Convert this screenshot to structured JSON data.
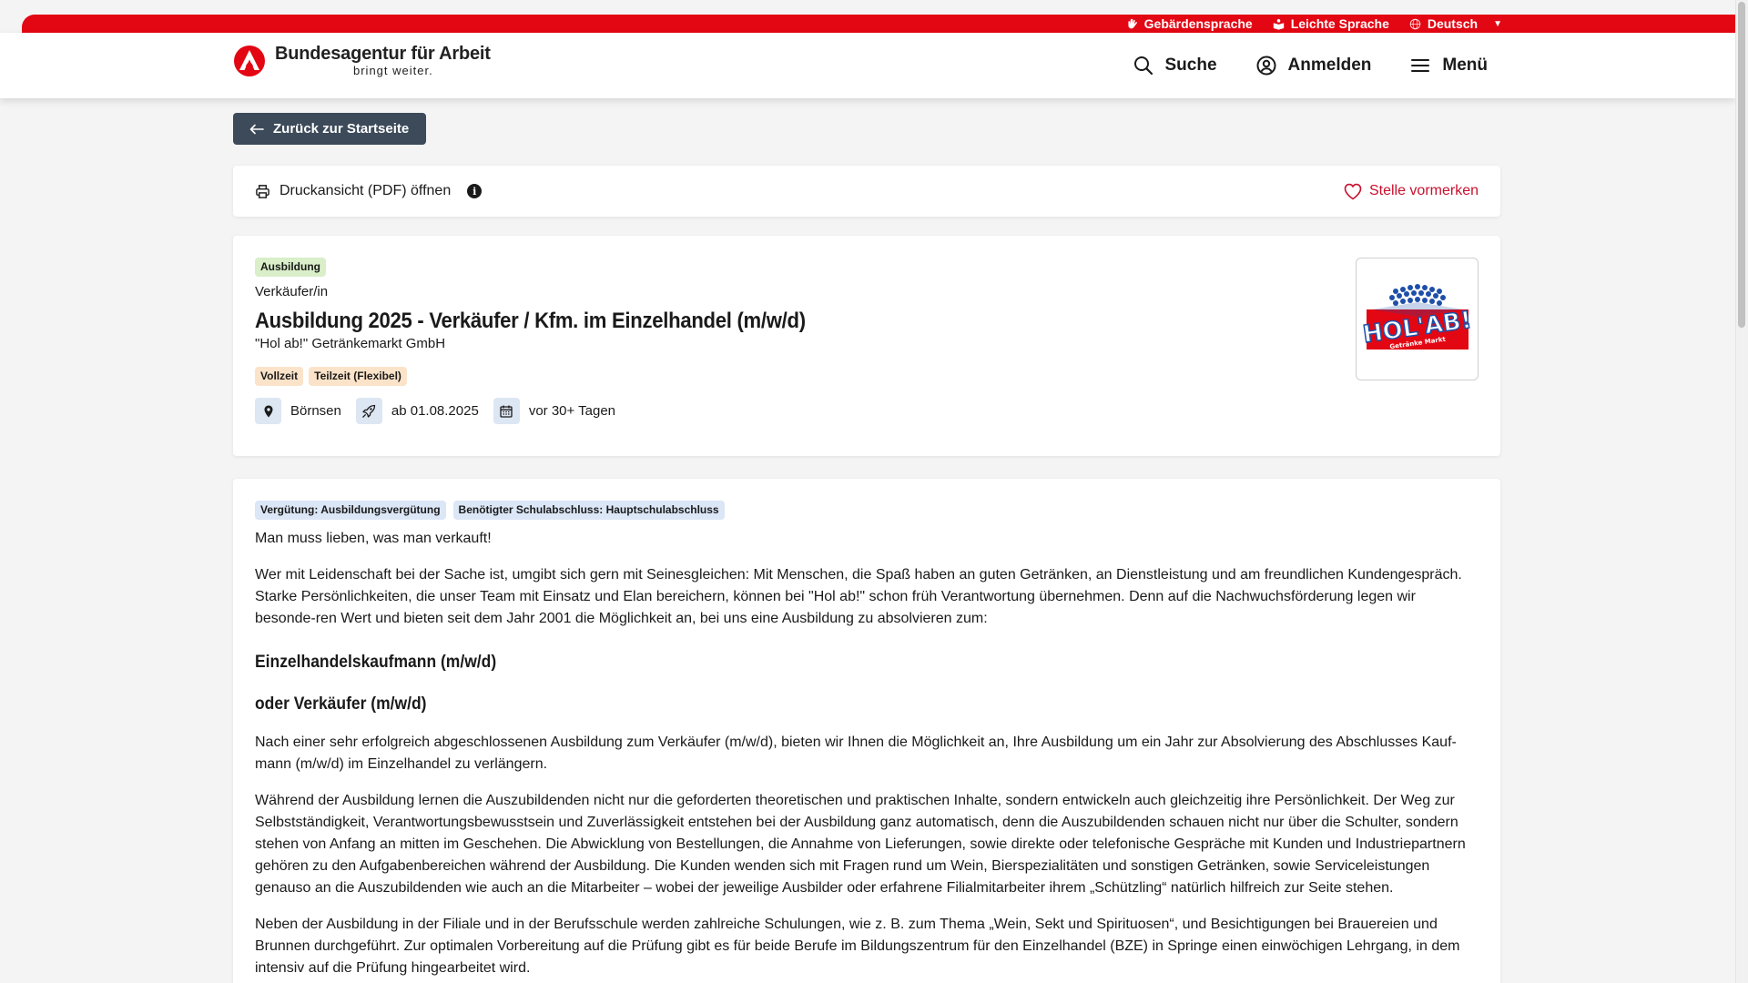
{
  "topbar": {
    "sign_language": "Gebärdensprache",
    "easy_language": "Leichte Sprache",
    "language": "Deutsch"
  },
  "header": {
    "brand_name": "Bundesagentur für Arbeit",
    "brand_tagline": "bringt weiter.",
    "search_label": "Suche",
    "login_label": "Anmelden",
    "menu_label": "Menü"
  },
  "back_button": "Zurück zur Startseite",
  "actions": {
    "print_label": "Druckansicht (PDF) öffnen",
    "bookmark_label": "Stelle vormerken"
  },
  "job": {
    "type_badge": "Ausbildung",
    "occupation": "Verkäufer/in",
    "title": "Ausbildung 2025 - Verkäufer / Kfm. im Einzelhandel (m/w/d)",
    "employer": "\"Hol ab!\" Getränkemarkt GmbH",
    "work_time": [
      "Vollzeit",
      "Teilzeit (Flexibel)"
    ],
    "location": "Börnsen",
    "start": "ab 01.08.2025",
    "posted": "vor 30+ Tagen",
    "logo_text": "HOL'AB!",
    "logo_subtext": "Getränke Markt"
  },
  "description": {
    "tags": [
      "Vergütung: Ausbildungsvergütung",
      "Benötigter Schulabschluss: Hauptschulabschluss"
    ],
    "intro": "Man muss lieben, was man verkauft!",
    "para1": "Wer mit Leidenschaft bei der Sache ist, umgibt sich gern mit Seinesgleichen: Mit Menschen, die Spaß haben an guten Getränken, an Dienstleistung und am freundlichen Kundengespräch. Starke Persönlichkeiten, die unser Team mit Einsatz und Elan bereichern, können bei \"Hol ab!\" schon früh Verantwortung übernehmen. Denn auf die Nachwuchsförderung legen wir besonde-ren Wert und bieten seit dem Jahr 2001 die Möglichkeit an, bei uns eine Ausbildung zu absolvieren zum:",
    "heading1": "Einzelhandelskaufmann (m/w/d)",
    "heading2": "oder Verkäufer (m/w/d)",
    "para2": "Nach einer sehr erfolgreich abgeschlossenen Ausbildung zum Verkäufer (m/w/d), bieten wir Ihnen die Möglichkeit an, Ihre Ausbildung um ein Jahr zur Absolvierung des Abschlusses Kauf-mann (m/w/d) im Einzelhandel zu verlängern.",
    "para3": "Während der Ausbildung lernen die Auszubildenden nicht nur die geforderten theoretischen und praktischen Inhalte, sondern entwickeln auch gleichzeitig ihre Persönlichkeit. Der Weg zur Selbstständigkeit, Verantwortungsbewusstsein und Zuverlässigkeit entstehen bei der Ausbildung ganz automatisch, denn die Auszubildenden schauen nicht nur über die Schulter, sondern stehen von Anfang an mitten im Geschehen. Die Abwicklung von Bestellungen, die Annahme von Lieferungen, sowie direkte oder telefonische Gespräche mit Kunden und Industriepartnern gehören zu den Aufgabenbereichen während der Ausbildung. Die Kunden wenden sich mit Fragen rund um Wein, Bierspezialitäten und sonstigen Getränken, sowie Serviceleistungen genauso an die Auszubildenden wie auch an die Mitarbeiter – wobei der jeweilige Ausbilder oder erfahrene Filialmitarbeiter ihrem „Schützling“ natürlich hilfreich zur Seite stehen.",
    "para4": "Neben der Ausbildung in der Filiale und in der Berufsschule werden zahlreiche Schulungen, wie z. B. zum Thema „Wein, Sekt und Spirituosen“, und Besichtigungen bei Brauereien und Brunnen durchgeführt. Zur optimalen Vorbereitung auf die Prüfung gibt es für beide Berufe im Bildungszentrum für den Einzelhandel (BZE) in Springe einen einwöchigen Lehrgang, in dem intensiv auf die Prüfung hingearbeitet wird."
  }
}
